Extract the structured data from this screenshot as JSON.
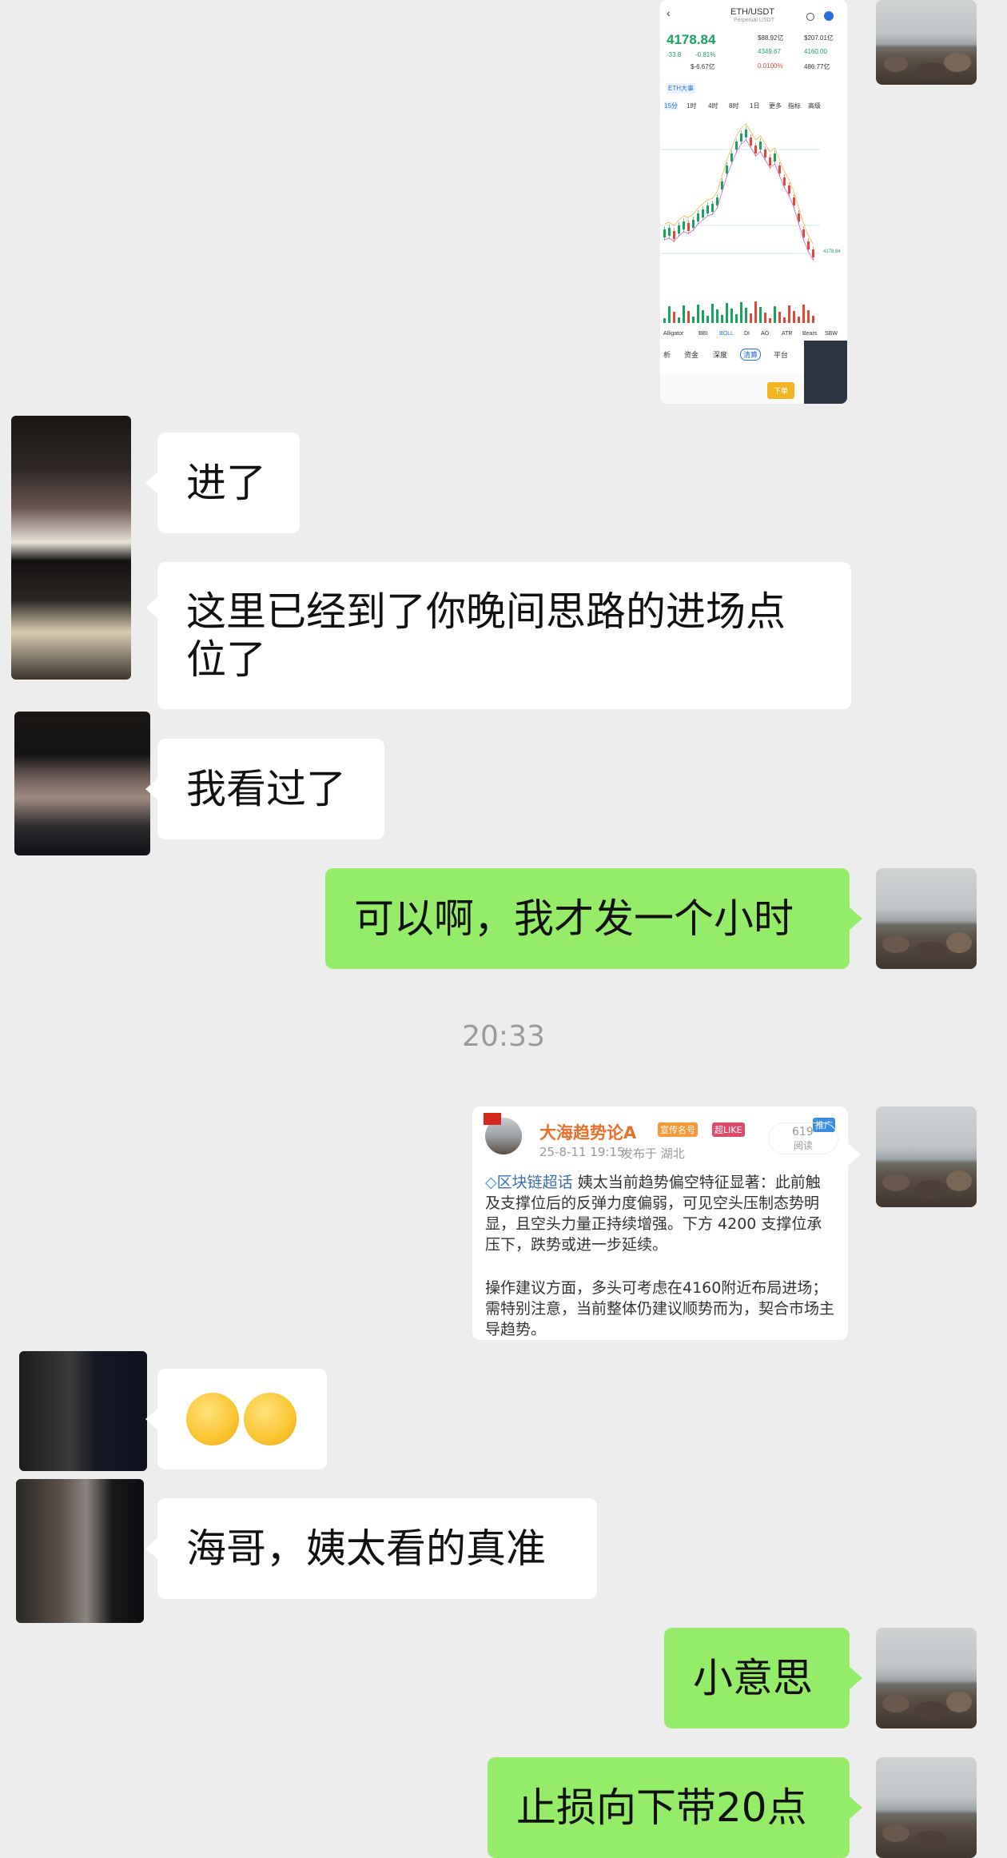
{
  "screenshot": {
    "pair": "ETH/USDT",
    "subtitle": "Perpetual USDT",
    "price": "4178.84",
    "price_unit": "USDT",
    "change_abs": "-33.8",
    "change_pct": "-0.81%",
    "stat_a": "$88.92亿",
    "stat_b": "$207.01亿",
    "stat_c": "4349.67",
    "stat_d": "4160.00",
    "stat_e": "0.0100%",
    "stat_f": "486.77亿",
    "stat_g": "$-6.67亿",
    "ticker_tag": "ETH大事",
    "tf_tabs": [
      "15分",
      "1时",
      "4时",
      "8时",
      "1日",
      "更多",
      "指标",
      "高级"
    ],
    "ind_tabs": [
      "Alligator",
      "BBI",
      "BOLL",
      "DI",
      "AO",
      "ATR",
      "Bears",
      "SBW"
    ],
    "sub_tabs": [
      "析",
      "资金",
      "深度",
      "清算",
      "平台"
    ],
    "last_price_label": "4178.84",
    "order_button": "下单"
  },
  "messages": [
    {
      "side": "left",
      "text": "进了"
    },
    {
      "side": "left",
      "text": "这里已经到了你晚间思路的进场点位了"
    },
    {
      "side": "left",
      "text": "我看过了"
    },
    {
      "side": "right",
      "text": "可以啊，我才发一个小时"
    },
    {
      "side": "right",
      "text": "小意思"
    },
    {
      "side": "right",
      "text": "止损向下带20点"
    },
    {
      "side": "left",
      "text": "海哥，姨太看的真准"
    }
  ],
  "timestamp": "20:33",
  "card": {
    "author": "大海趋势论A",
    "badge_1": "宣传名号",
    "badge_2": "超LIKE",
    "promo": "推广",
    "reads_count": "619",
    "reads_label": "阅读",
    "date": "25-8-11 19:15",
    "location": "发布于 湖北",
    "topic": "区块链超话",
    "para1": "姨太当前趋势偏空特征显著：此前触及支撑位后的反弹力度偏弱，可见空头压制态势明显，且空头力量正持续增强。下方 4200 支撑位承压下，跌势或进一步延续。",
    "para2": "操作建议方面，多头可考虑在4160附近布局进场；需特别注意，当前整体仍建议顺势而为，契合市场主导趋势。"
  },
  "emoji_reaction": "😁😁",
  "colors": {
    "background": "#ededed",
    "bubble_green": "#95ec69",
    "bubble_white": "#ffffff",
    "price_green": "#1aa260",
    "down_red": "#e04a3a"
  }
}
